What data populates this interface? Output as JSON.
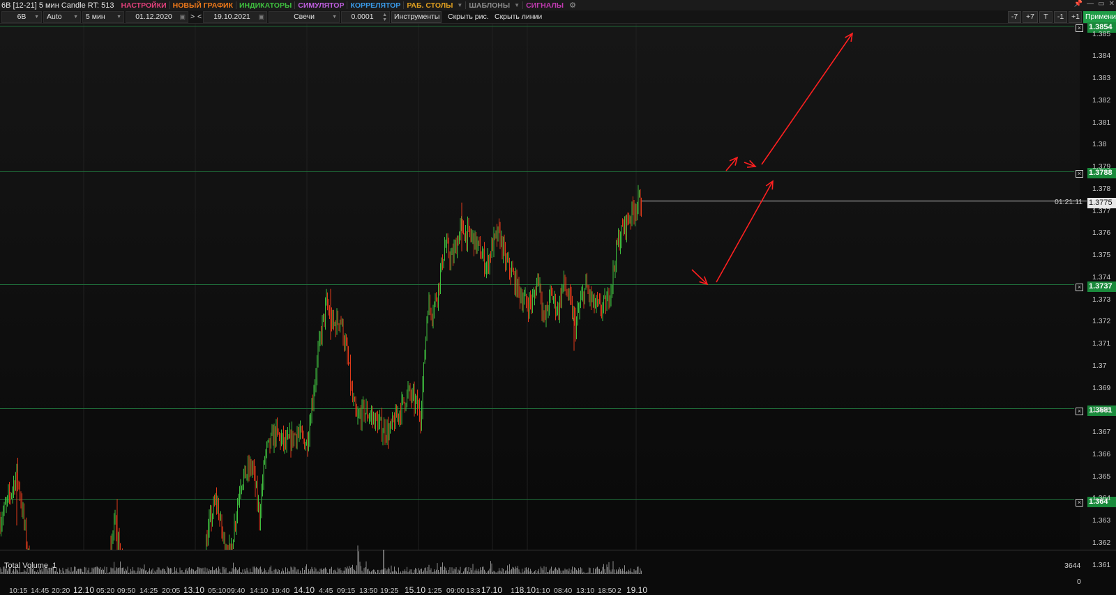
{
  "window": {
    "title": "6B [12-21] 5 мин Candle RT: 513",
    "controls": [
      "📌",
      "—",
      "▭",
      "✕"
    ]
  },
  "menu": [
    {
      "label": "НАСТРОЙКИ",
      "color": "#e0407a",
      "dropdown": false
    },
    {
      "label": "НОВЫЙ ГРАФИК",
      "color": "#f07a1a",
      "dropdown": false
    },
    {
      "label": "ИНДИКАТОРЫ",
      "color": "#3fbf3f",
      "dropdown": false
    },
    {
      "label": "СИМУЛЯТОР",
      "color": "#c060e0",
      "dropdown": false
    },
    {
      "label": "КОРРЕЛЯТОР",
      "color": "#3a9ae8",
      "dropdown": false
    },
    {
      "label": "РАБ. СТОЛЫ",
      "color": "#e0a020",
      "dropdown": true
    },
    {
      "label": "ШАБЛОНЫ",
      "color": "#8a8a8a",
      "dropdown": true
    },
    {
      "label": "СИГНАЛЫ",
      "color": "#c03ab0",
      "dropdown": false
    }
  ],
  "toolbar": {
    "symbol": "6B",
    "scale": "Auto",
    "timeframe": "5 мин",
    "date_from": "01.12.2020",
    "nav_next": ">",
    "nav_prev": "<",
    "date_to": "19.10.2021",
    "chart_type": "Свечи",
    "tick_size": "0.0001",
    "tools": "Инструменты",
    "hide_drawings": "Скрыть рис.",
    "hide_lines": "Скрыть линии",
    "zoom": [
      "-7",
      "+7",
      "T",
      "-1",
      "+1"
    ],
    "apply": "Применить"
  },
  "price_axis": {
    "ticks": [
      "1.385",
      "1.384",
      "1.383",
      "1.382",
      "1.381",
      "1.38",
      "1.379",
      "1.378",
      "1.377",
      "1.376",
      "1.375",
      "1.374",
      "1.373",
      "1.372",
      "1.371",
      "1.37",
      "1.369",
      "1.368",
      "1.367",
      "1.366",
      "1.365",
      "1.364",
      "1.363",
      "1.362",
      "1.361"
    ],
    "levels": [
      "1.3854",
      "1.3788",
      "1.3737",
      "1.3681",
      "1.364"
    ],
    "current_price": "1.3775",
    "timer": "01:21:11"
  },
  "volume": {
    "label": "Total Volume_1",
    "max": "3644",
    "min": "0"
  },
  "time_axis": [
    {
      "t": "10:15",
      "day": false
    },
    {
      "t": "14:45",
      "day": false
    },
    {
      "t": "20:20",
      "day": false
    },
    {
      "t": "12.10",
      "day": true
    },
    {
      "t": "05:20",
      "day": false
    },
    {
      "t": "09:50",
      "day": false
    },
    {
      "t": "14:25",
      "day": false
    },
    {
      "t": "20:05",
      "day": false
    },
    {
      "t": "13.10",
      "day": true
    },
    {
      "t": "05:10",
      "day": false
    },
    {
      "t": "09:40",
      "day": false
    },
    {
      "t": "14:10",
      "day": false
    },
    {
      "t": "19:40",
      "day": false
    },
    {
      "t": "14.10",
      "day": true
    },
    {
      "t": "4:45",
      "day": false
    },
    {
      "t": "09:15",
      "day": false
    },
    {
      "t": "13:50",
      "day": false
    },
    {
      "t": "19:25",
      "day": false
    },
    {
      "t": "15.10",
      "day": true
    },
    {
      "t": "1:25",
      "day": false
    },
    {
      "t": "09:00",
      "day": false
    },
    {
      "t": "13:3",
      "day": false
    },
    {
      "t": "17.10",
      "day": true
    },
    {
      "t": "1",
      "day": false
    },
    {
      "t": "18.10",
      "day": true
    },
    {
      "t": "1:10",
      "day": false
    },
    {
      "t": "08:40",
      "day": false
    },
    {
      "t": "13:10",
      "day": false
    },
    {
      "t": "18:50",
      "day": false
    },
    {
      "t": "2",
      "day": false
    },
    {
      "t": "19.10",
      "day": true
    }
  ],
  "colors": {
    "up": "#3fbf3f",
    "down": "#e03a1a",
    "level_line": "#1f6e3a",
    "annotation": "#ff2020",
    "background": "#0d0d0d"
  }
}
